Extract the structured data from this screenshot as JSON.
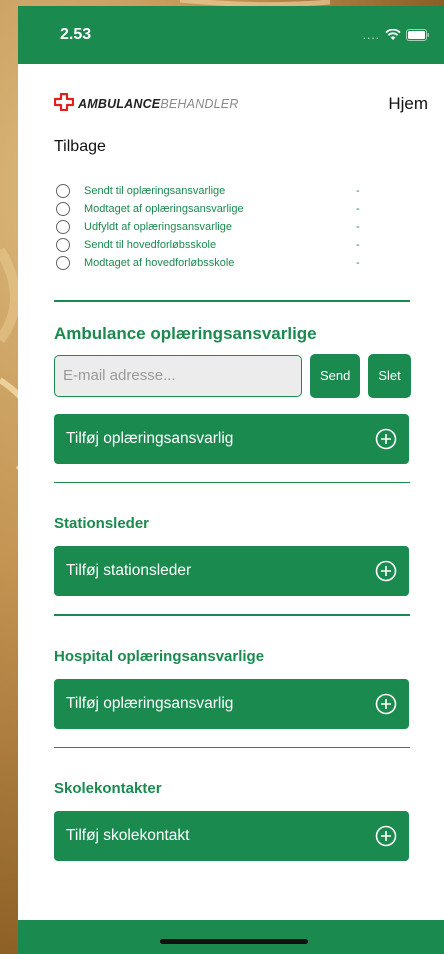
{
  "status_bar": {
    "time": "2.53",
    "signal": "....",
    "wifi_icon": "wifi-icon",
    "battery_icon": "battery-icon"
  },
  "header": {
    "logo_icon": "red-cross-icon",
    "logo_part_a": "AMBULANCE",
    "logo_part_b": "BEHANDLER",
    "home_label": "Hjem"
  },
  "back_label": "Tilbage",
  "statuses": [
    {
      "label": "Sendt til oplæringsansvarlige",
      "value": "-"
    },
    {
      "label": "Modtaget af oplæringsansvarlige",
      "value": "-"
    },
    {
      "label": "Udfyldt af oplæringsansvarlige",
      "value": "-"
    },
    {
      "label": "Sendt til hovedforløbsskole",
      "value": "-"
    },
    {
      "label": "Modtaget af hovedforløbsskole",
      "value": "-"
    }
  ],
  "sections": {
    "ambulance": {
      "title": "Ambulance oplæringsansvarlige",
      "email_placeholder": "E-mail adresse...",
      "send_label": "Send",
      "delete_label": "Slet",
      "add_label": "Tilføj oplæringsansvarlig"
    },
    "station": {
      "title": "Stationsleder",
      "add_label": "Tilføj stationsleder"
    },
    "hospital": {
      "title": "Hospital oplæringsansvarlige",
      "add_label": "Tilføj oplæringsansvarlig"
    },
    "school": {
      "title": "Skolekontakter",
      "add_label": "Tilføj skolekontakt"
    }
  },
  "colors": {
    "primary": "#1b8a4f",
    "logo_red": "#e02020"
  }
}
